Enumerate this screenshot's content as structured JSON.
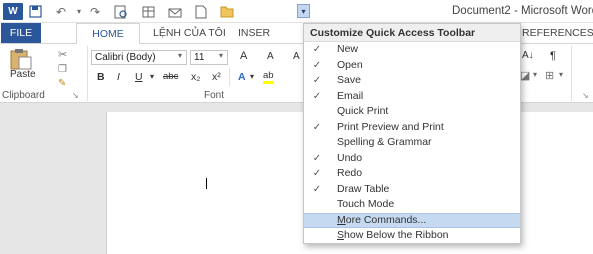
{
  "window": {
    "title": "Document2 - Microsoft Word",
    "title_visible": "Document2 - Microsoft Word"
  },
  "qat": {
    "customize_glyph": "▾"
  },
  "tabs": {
    "file": "FILE",
    "home": "HOME",
    "lenh": "LỆNH CỦA TÔI",
    "insert": "INSER",
    "references": "REFERENCES"
  },
  "ribbon": {
    "paste_label": "Paste",
    "clipboard_group": "Clipboard",
    "font_group": "Font",
    "font_name": "Calibri (Body)",
    "font_size": "11",
    "bold": "B",
    "italic": "I",
    "underline": "U",
    "strike": "abc",
    "subscript": "x₂",
    "superscript": "x²",
    "grow": "A",
    "shrink": "A",
    "text_effects": "A",
    "highlight": "ab",
    "right_a": "A",
    "sort": "A↓",
    "pilcrow": "¶"
  },
  "menu": {
    "header": "Customize Quick Access Toolbar",
    "items": [
      {
        "label": "New",
        "checked": true
      },
      {
        "label": "Open",
        "checked": true
      },
      {
        "label": "Save",
        "checked": true
      },
      {
        "label": "Email",
        "checked": true
      },
      {
        "label": "Quick Print",
        "checked": false
      },
      {
        "label": "Print Preview and Print",
        "checked": true
      },
      {
        "label": "Spelling & Grammar",
        "checked": false
      },
      {
        "label": "Undo",
        "checked": true
      },
      {
        "label": "Redo",
        "checked": true
      },
      {
        "label": "Draw Table",
        "checked": true
      },
      {
        "label": "Touch Mode",
        "checked": false
      }
    ],
    "more_commands": "More Commands...",
    "more_commands_u": "M",
    "more_commands_rest": "ore Commands...",
    "show_below": "Show Below the Ribbon",
    "show_below_u": "S",
    "show_below_rest": "how Below the Ribbon"
  },
  "colors": {
    "accent": "#2b579a",
    "menu_hover": "#c5d9f1"
  }
}
